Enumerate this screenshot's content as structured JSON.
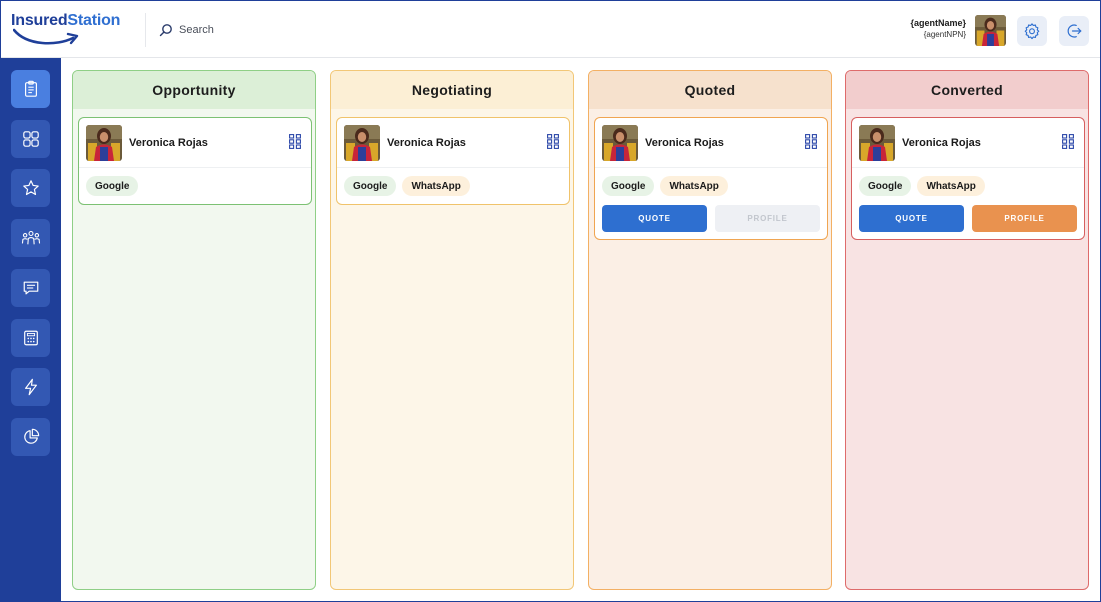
{
  "app": {
    "logo_part1": "Insured",
    "logo_part2": "Station"
  },
  "header": {
    "search_placeholder": "Search",
    "agent_name": "{agentName}",
    "agent_npn": "{agentNPN}"
  },
  "icons": {
    "search": "search-icon",
    "settings": "gear-icon",
    "logout": "logout-icon",
    "sidebar": [
      "clipboard-icon",
      "dashboard-grid-icon",
      "star-icon",
      "people-icon",
      "chat-icon",
      "calculator-icon",
      "lightning-icon",
      "pie-chart-icon"
    ]
  },
  "colors": {
    "brand_dark": "#1f3f99",
    "brand_light": "#2f6fd1",
    "opportunity_bg": "#f2f8ef",
    "negotiating_bg": "#fdf6e8",
    "quoted_bg": "#fbefe5",
    "converted_bg": "#f8e3e3"
  },
  "board": {
    "columns": [
      {
        "title": "Opportunity",
        "card": {
          "name": "Veronica Rojas",
          "tags": [
            "Google"
          ]
        }
      },
      {
        "title": "Negotiating",
        "card": {
          "name": "Veronica Rojas",
          "tags": [
            "Google",
            "WhatsApp"
          ]
        }
      },
      {
        "title": "Quoted",
        "card": {
          "name": "Veronica Rojas",
          "tags": [
            "Google",
            "WhatsApp"
          ],
          "quote_label": "QUOTE",
          "profile_label": "PROFILE"
        }
      },
      {
        "title": "Converted",
        "card": {
          "name": "Veronica Rojas",
          "tags": [
            "Google",
            "WhatsApp"
          ],
          "quote_label": "QUOTE",
          "profile_label": "PROFILE"
        }
      }
    ]
  }
}
